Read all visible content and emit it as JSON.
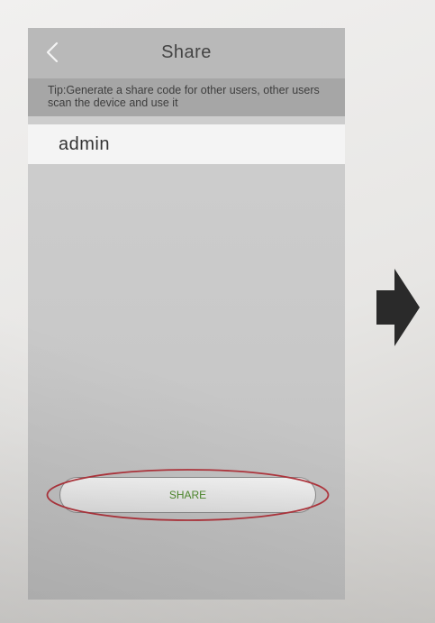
{
  "screen": {
    "title": "Share",
    "tip": "Tip:Generate a share code for other users, other users scan the device and use it",
    "user": "admin",
    "share_button_label": "SHARE"
  },
  "colors": {
    "nav_bar": "#b9b9b9",
    "tip_bar": "#a6a6a6",
    "user_row": "#f4f4f4",
    "share_label": "#4f8a2e",
    "highlight_ring": "#b0353d",
    "arrow": "#2a2a2a"
  },
  "icons": {
    "back": "chevron-left-icon",
    "next_step": "arrow-right-icon"
  }
}
